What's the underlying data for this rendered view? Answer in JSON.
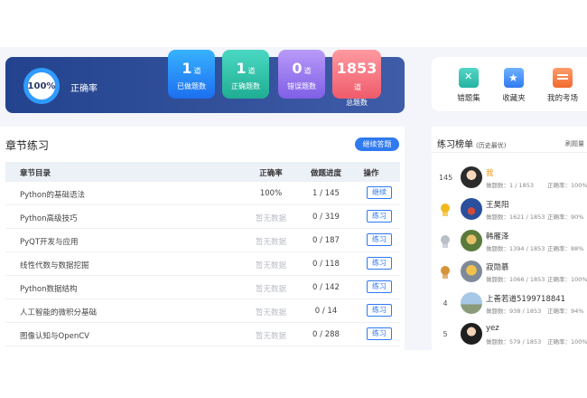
{
  "stats": {
    "accuracy_ring": "100%",
    "accuracy_label": "正确率",
    "cards": [
      {
        "value": "1",
        "unit": "道",
        "label": "已做题数"
      },
      {
        "value": "1",
        "unit": "道",
        "label": "正确题数"
      },
      {
        "value": "0",
        "unit": "道",
        "label": "错误题数"
      },
      {
        "value": "1853",
        "unit": "道",
        "label": "总题数"
      }
    ]
  },
  "quick_links": [
    {
      "label": "错题集",
      "icon": "mistake-book-icon"
    },
    {
      "label": "收藏夹",
      "icon": "favorites-folder-icon"
    },
    {
      "label": "我的考场",
      "icon": "exam-room-icon"
    }
  ],
  "chapter": {
    "title": "章节练习",
    "continue_label": "继续答题",
    "headers": {
      "name": "章节目录",
      "accuracy": "正确率",
      "progress": "做题进度",
      "action": "操作"
    },
    "rows": [
      {
        "name": "Python的基础语法",
        "accuracy": "100%",
        "progress": "1 / 145",
        "action": "继续"
      },
      {
        "name": "Python高级技巧",
        "accuracy": "暂无数据",
        "progress": "0 / 319",
        "action": "练习"
      },
      {
        "name": "PyQT开发与应用",
        "accuracy": "暂无数据",
        "progress": "0 / 187",
        "action": "练习"
      },
      {
        "name": "线性代数与数据挖掘",
        "accuracy": "暂无数据",
        "progress": "0 / 118",
        "action": "练习"
      },
      {
        "name": "Python数据结构",
        "accuracy": "暂无数据",
        "progress": "0 / 142",
        "action": "练习"
      },
      {
        "name": "人工智能的微积分基础",
        "accuracy": "暂无数据",
        "progress": "0 / 14",
        "action": "练习"
      },
      {
        "name": "图像认知与OpenCV",
        "accuracy": "暂无数据",
        "progress": "0 / 288",
        "action": "练习"
      }
    ]
  },
  "leaderboard": {
    "title": "练习榜单",
    "subtitle": "(历史最优)",
    "right_label": "刷题量",
    "entries": [
      {
        "rank": "145",
        "name": "我",
        "count": "做题数：1 / 1853",
        "rate": "正确率：100%"
      },
      {
        "rank": "",
        "medal": "gold",
        "name": "王昊阳",
        "count": "做题数：1621 / 1853",
        "rate": "正确率：90%"
      },
      {
        "rank": "",
        "medal": "silver",
        "name": "韩雁泽",
        "count": "做题数：1394 / 1853",
        "rate": "正确率：88%"
      },
      {
        "rank": "",
        "medal": "bronze",
        "name": "寂勋慕",
        "count": "做题数：1066 / 1853",
        "rate": "正确率：100%"
      },
      {
        "rank": "4",
        "name": "上善若道5199718841",
        "count": "做题数：938 / 1853",
        "rate": "正确率：94%"
      },
      {
        "rank": "5",
        "name": "yez",
        "count": "做题数：579 / 1853",
        "rate": "正确率：100%"
      }
    ]
  }
}
